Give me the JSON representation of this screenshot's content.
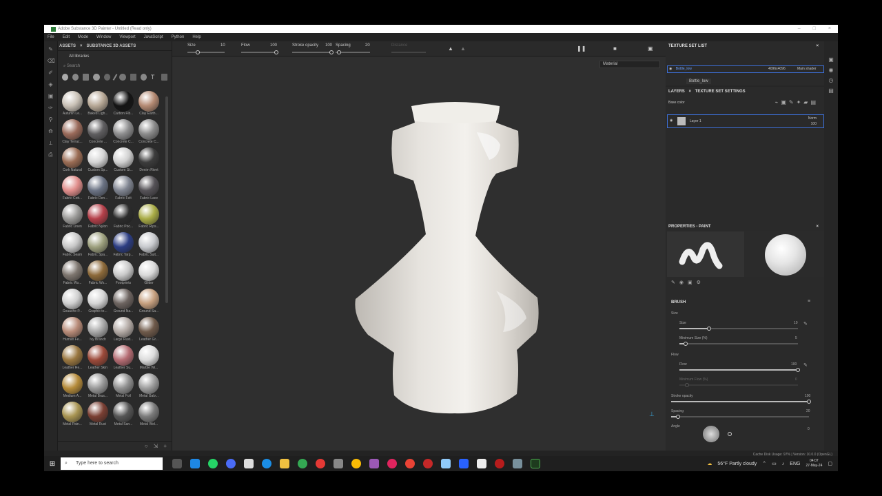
{
  "window": {
    "title": "Adobe Substance 3D Painter - Untitled (Read only)"
  },
  "menu": [
    "File",
    "Edit",
    "Mode",
    "Window",
    "Viewport",
    "JavaScript",
    "Python",
    "Help"
  ],
  "assets": {
    "tab_assets": "ASSETS",
    "tab_close": "×",
    "tab_substance": "SUBSTANCE 3D ASSETS",
    "library": "All libraries",
    "search_placeholder": "Search",
    "materials": [
      {
        "name": "Autumn Le...",
        "color": "#c9c1b6"
      },
      {
        "name": "Baked Ligh...",
        "color": "#b7a896"
      },
      {
        "name": "Carbon Fib...",
        "color": "#141414"
      },
      {
        "name": "Clay Earth...",
        "color": "#b48a73"
      },
      {
        "name": "Clay Terrac...",
        "color": "#9a6a5a"
      },
      {
        "name": "Concrete ...",
        "color": "#5f5e60"
      },
      {
        "name": "Concrete C...",
        "color": "#8d8d8e"
      },
      {
        "name": "Concrete C...",
        "color": "#8a8a8a"
      },
      {
        "name": "Cork Natural",
        "color": "#9a6c54"
      },
      {
        "name": "Custom Sp...",
        "color": "#d5d5d5"
      },
      {
        "name": "Custom St...",
        "color": "#d0d0d0"
      },
      {
        "name": "Denim Rivet",
        "color": "#3c3c3c"
      },
      {
        "name": "Fabric Cott...",
        "color": "#e08d8b"
      },
      {
        "name": "Fabric Den...",
        "color": "#6b7384"
      },
      {
        "name": "Fabric Felt",
        "color": "#7f8490"
      },
      {
        "name": "Fabric Lace",
        "color": "#555257"
      },
      {
        "name": "Fabric Linen",
        "color": "#9b9a98"
      },
      {
        "name": "Fabric Nylon",
        "color": "#b5404a"
      },
      {
        "name": "Fabric Poc...",
        "color": "#2c2c2c"
      },
      {
        "name": "Fabric Rips...",
        "color": "#a9ac46"
      },
      {
        "name": "Fabric Seam",
        "color": "#c7c7c7"
      },
      {
        "name": "Fabric Spa...",
        "color": "#9da07e"
      },
      {
        "name": "Fabric Tarp...",
        "color": "#2c3d82"
      },
      {
        "name": "Fabric Suit...",
        "color": "#c7c9cd"
      },
      {
        "name": "Fabric Wo...",
        "color": "#7e766f"
      },
      {
        "name": "Fabric Wo...",
        "color": "#8d6a3a"
      },
      {
        "name": "Footprints",
        "color": "#c9c9c9"
      },
      {
        "name": "Glitter",
        "color": "#d9d9d9"
      },
      {
        "name": "Gouache P...",
        "color": "#d0d0d0"
      },
      {
        "name": "Graphic to...",
        "color": "#d5d5d5"
      },
      {
        "name": "Ground Na...",
        "color": "#6d6460"
      },
      {
        "name": "Ground Sa...",
        "color": "#c6a07f"
      },
      {
        "name": "Human Fe...",
        "color": "#b88b78"
      },
      {
        "name": "Ivy Branch",
        "color": "#a9a9a9"
      },
      {
        "name": "Large Rust...",
        "color": "#b3aaa5"
      },
      {
        "name": "Leather Gr...",
        "color": "#6f5a4a"
      },
      {
        "name": "Leather Re...",
        "color": "#9a7740"
      },
      {
        "name": "Leather Skin",
        "color": "#9c4a3a"
      },
      {
        "name": "Leather Su...",
        "color": "#b56c73"
      },
      {
        "name": "Marble Wi...",
        "color": "#dcdcdc"
      },
      {
        "name": "Medium A...",
        "color": "#b58b3a"
      },
      {
        "name": "Metal Brus...",
        "color": "#9a9a9a"
      },
      {
        "name": "Metal Foil",
        "color": "#8f8f8f"
      },
      {
        "name": "Metal Galv...",
        "color": "#9e9e9e"
      },
      {
        "name": "Metal Pain...",
        "color": "#a89452"
      },
      {
        "name": "Metal Rust",
        "color": "#7a3f33"
      },
      {
        "name": "Metal San...",
        "color": "#555"
      },
      {
        "name": "Metal Wel...",
        "color": "#7b7b7b"
      }
    ]
  },
  "toolbar": {
    "size_label": "Size",
    "size_value": "10",
    "flow_label": "Flow",
    "flow_value": "100",
    "stroke_label": "Stroke opacity",
    "stroke_value": "100",
    "spacing_label": "Spacing",
    "spacing_value": "20",
    "distance_label": "Distance"
  },
  "viewport": {
    "material_mode": "Material"
  },
  "texture_set": {
    "title": "TEXTURE SET LIST",
    "row_name": "Bottle_low",
    "row_res": "4096x4096",
    "row_shader": "Main shader",
    "tooltip": "Bottle_low"
  },
  "layers": {
    "tab_layers": "LAYERS",
    "tab_settings": "TEXTURE SET SETTINGS",
    "channel": "Base color",
    "layer_name": "Layer 1",
    "blend": "Norm",
    "opacity": "100"
  },
  "properties": {
    "title": "PROPERTIES - PAINT",
    "section": "BRUSH",
    "size_group": "Size",
    "size_label": "Size",
    "size_value": "10",
    "size_level": 0.25,
    "min_size_label": "Minimum Size (%)",
    "min_size_value": "5",
    "min_size_level": 0.05,
    "flow_group": "Flow",
    "flow_label": "Flow",
    "flow_value": "100",
    "flow_level": 1.0,
    "min_flow_label": "Minimum Flow (%)",
    "min_flow_value": "0",
    "stroke_label": "Stroke opacity",
    "stroke_value": "100",
    "stroke_level": 1.0,
    "spacing_label": "Spacing",
    "spacing_value": "20",
    "spacing_level": 0.05,
    "angle_label": "Angle",
    "angle_value": "0"
  },
  "status": {
    "text": "Cache Disk Usage:  97%  |  Version: 10.0.0 (OpenGL)"
  },
  "taskbar": {
    "search_placeholder": "Type here to search",
    "weather": "56°F  Partly cloudy",
    "lang": "ENG",
    "time": "04:07",
    "date": "27-May-24"
  }
}
